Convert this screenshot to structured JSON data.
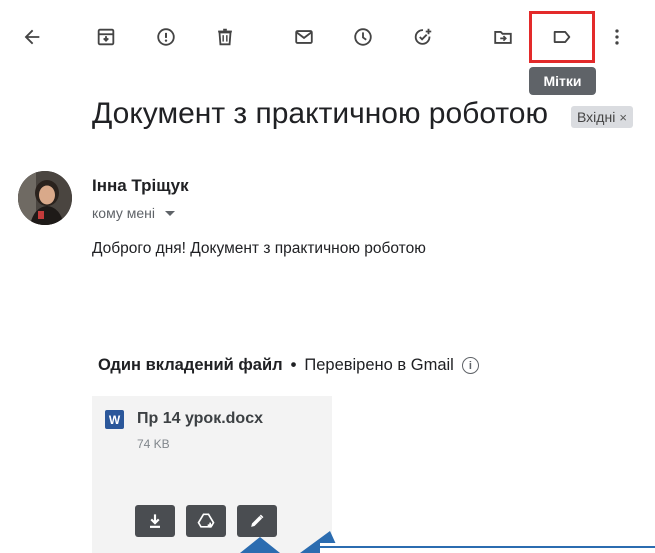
{
  "toolbar": {
    "icons": [
      "back-arrow-icon",
      "archive-icon",
      "report-spam-icon",
      "delete-icon",
      "mark-unread-icon",
      "snooze-icon",
      "add-to-tasks-icon",
      "move-to-icon",
      "label-icon",
      "more-options-icon"
    ],
    "tooltip": "Мітки"
  },
  "email": {
    "subject": "Документ з практичною роботою",
    "label_chip": "Вхідні",
    "label_chip_close": "×",
    "sender": "Інна Тріщук",
    "recipient": "кому мені",
    "body": "Доброго дня! Документ з практичною роботою"
  },
  "attachments": {
    "count_text": "Один вкладений файл",
    "separator": "•",
    "verified_text": "Перевірено в Gmail",
    "info_glyph": "i",
    "file": {
      "type_glyph": "W",
      "name": "Пр 14 урок.docx",
      "size": "74 KB"
    },
    "actions": [
      "download-icon",
      "save-to-drive-icon",
      "edit-icon"
    ]
  },
  "colors": {
    "highlight": "#e32a2a",
    "tooltip_bg": "#5f6368",
    "word_blue": "#2b579a"
  }
}
